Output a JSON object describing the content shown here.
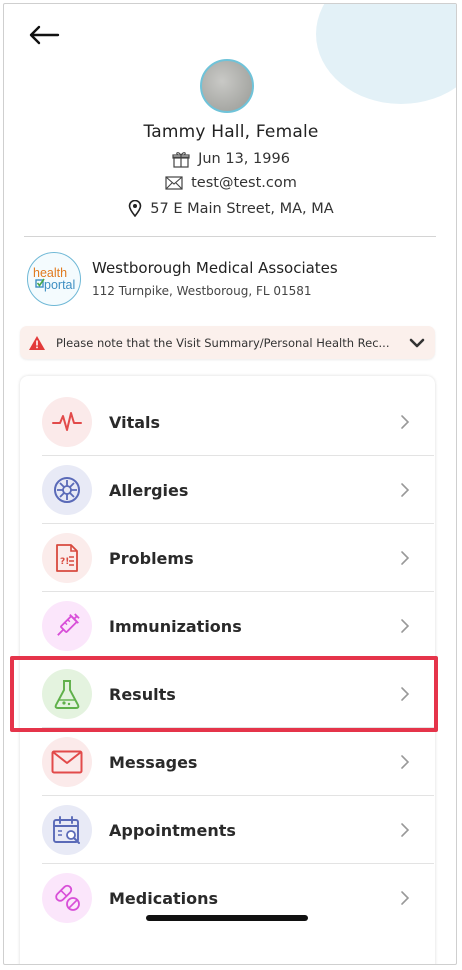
{
  "profile": {
    "name": "Tammy Hall, Female",
    "dob": "Jun 13, 1996",
    "email": "test@test.com",
    "address": "57 E Main Street, MA, MA"
  },
  "practice": {
    "name": "Westborough Medical Associates",
    "address": "112 Turnpike, Westboroug, FL 01581",
    "logo_word1": "health",
    "logo_word2": "portal"
  },
  "notice": {
    "text": "Please note that the Visit Summary/Personal Health Rec..."
  },
  "menu": {
    "items": [
      {
        "label": "Vitals",
        "icon": "heartbeat-icon"
      },
      {
        "label": "Allergies",
        "icon": "allergen-icon"
      },
      {
        "label": "Problems",
        "icon": "problem-document-icon"
      },
      {
        "label": "Immunizations",
        "icon": "syringe-icon"
      },
      {
        "label": "Results",
        "icon": "flask-icon"
      },
      {
        "label": "Messages",
        "icon": "envelope-icon"
      },
      {
        "label": "Appointments",
        "icon": "calendar-search-icon"
      },
      {
        "label": "Medications",
        "icon": "pills-icon"
      }
    ]
  },
  "colors": {
    "accent_teal": "#6fc3d9",
    "highlight_red": "#e5344a",
    "vitals_red": "#e24a4a",
    "allergies_blue": "#5a6ab8",
    "immunizations_pink": "#d84fd8",
    "results_green": "#5fb04a"
  }
}
